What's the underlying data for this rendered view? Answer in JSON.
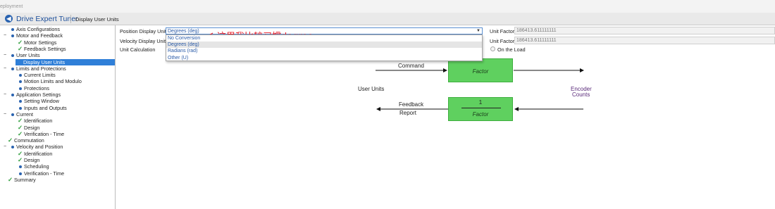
{
  "window": {
    "faded_label": "eployment",
    "app_title": "Drive Expert Tuner",
    "page_tab": "Display User Units"
  },
  "sidebar": {
    "items": [
      {
        "label": "Axis Configurations",
        "state": "bullet"
      },
      {
        "label": "Motor and Feedback",
        "state": "bullet",
        "toggle": "−"
      },
      {
        "label": "Motor Settings",
        "state": "check"
      },
      {
        "label": "Feedback Settings",
        "state": "check"
      },
      {
        "label": "User Units",
        "state": "bullet",
        "toggle": "−"
      },
      {
        "label": "Display User Units",
        "state": "selected"
      },
      {
        "label": "Limits and Protections",
        "state": "bullet",
        "toggle": "−"
      },
      {
        "label": "Current Limits",
        "state": "bullet"
      },
      {
        "label": "Motion Limits and Modulo",
        "state": "bullet"
      },
      {
        "label": "Protections",
        "state": "bullet"
      },
      {
        "label": "Application Settings",
        "state": "bullet",
        "toggle": "−"
      },
      {
        "label": "Setting Window",
        "state": "bullet"
      },
      {
        "label": "Inputs and Outputs",
        "state": "bullet"
      },
      {
        "label": "Current",
        "state": "bullet",
        "toggle": "−"
      },
      {
        "label": "Identification",
        "state": "check"
      },
      {
        "label": "Design",
        "state": "check"
      },
      {
        "label": "Verification - Time",
        "state": "check"
      },
      {
        "label": "Commutation",
        "state": "check"
      },
      {
        "label": "Velocity and Position",
        "state": "bullet",
        "toggle": "−"
      },
      {
        "label": "Identification",
        "state": "check"
      },
      {
        "label": "Design",
        "state": "check"
      },
      {
        "label": "Scheduling",
        "state": "bullet"
      },
      {
        "label": "Verification - Time",
        "state": "bullet"
      },
      {
        "label": "Summary",
        "state": "check"
      }
    ]
  },
  "settings": {
    "position_label": "Position Display Units",
    "velocity_label": "Velocity Display Units",
    "unit_calc_label": "Unit Calculation",
    "position_value": "Degrees (deg)",
    "options": [
      "No Conversion",
      "Degrees (deg)",
      "Radians (rad)",
      "Other (U)"
    ],
    "hovered_option": 1,
    "unit_factor_label": "Unit Factor",
    "unit_factor_1": "186413.611111111",
    "unit_factor_2": "186413.611111111",
    "on_the_load_label": "On the Load",
    "annotation": "这里我比较习惯degree"
  },
  "diagram": {
    "command": "Command",
    "factor": "Factor",
    "user_units": "User Units",
    "encoder": "Encoder",
    "counts": "Counts",
    "feedback": "Feedback",
    "report": "Report",
    "one": "1"
  },
  "colors": {
    "box_fill": "#5fd05f",
    "selection": "#2f7fd8",
    "annotation": "#e8202a",
    "check": "#2e9e3b"
  }
}
